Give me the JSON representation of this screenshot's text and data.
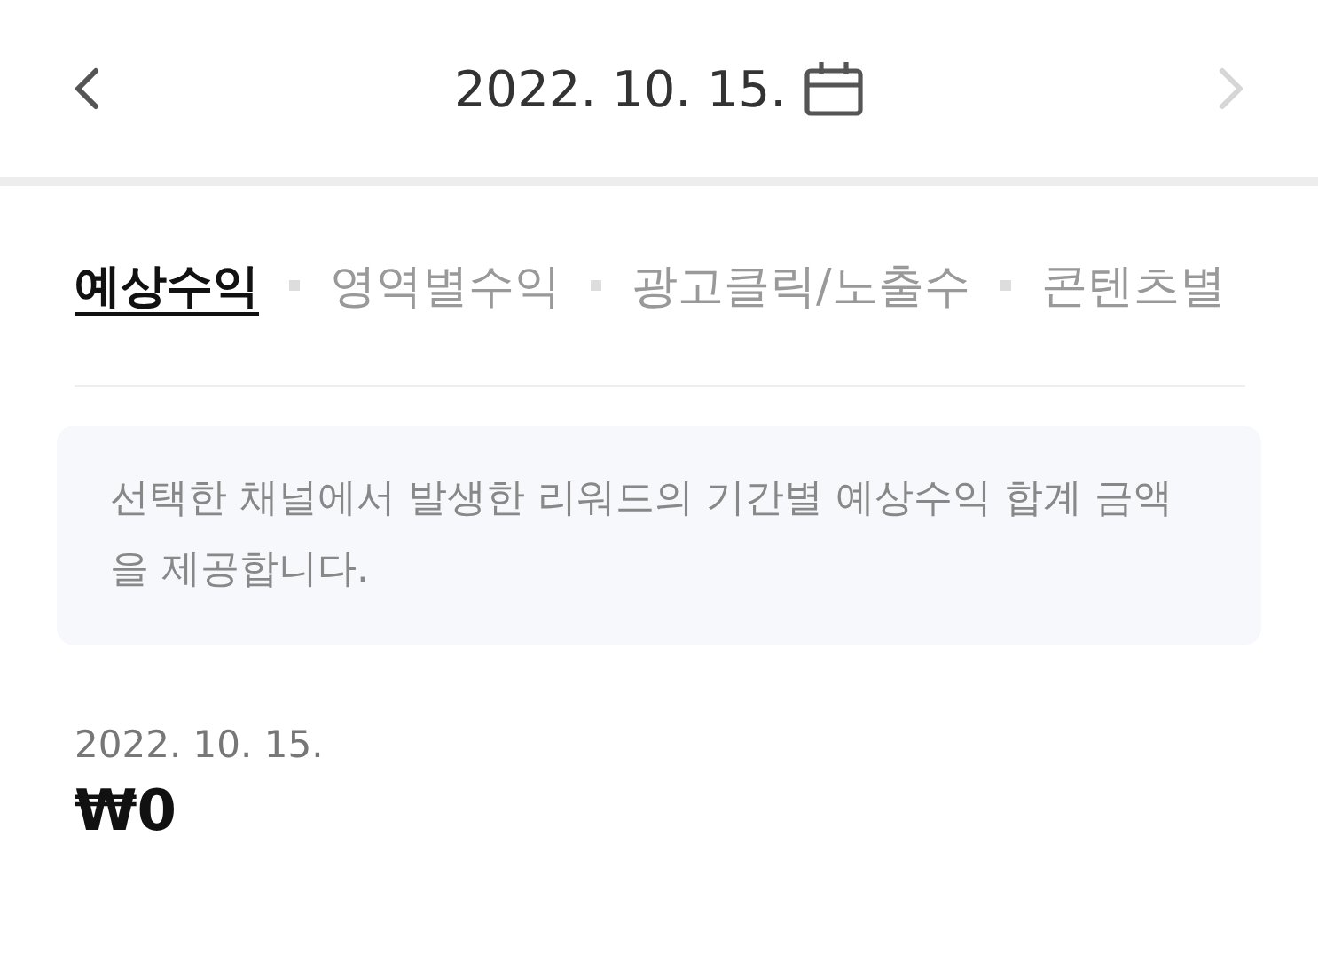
{
  "header": {
    "date": "2022. 10. 15.",
    "prev": {
      "disabled": false
    },
    "next": {
      "disabled": true
    }
  },
  "tabs": [
    {
      "label": "예상수익",
      "selected": true
    },
    {
      "label": "영역별수익",
      "selected": false
    },
    {
      "label": "광고클릭/노출수",
      "selected": false
    },
    {
      "label": "콘텐츠별",
      "selected": false
    }
  ],
  "notice": "선택한 채널에서 발생한 리워드의 기간별 예상수익 합계 금액을 제공합니다.",
  "summary": {
    "date": "2022. 10. 15.",
    "amount": "₩0"
  }
}
